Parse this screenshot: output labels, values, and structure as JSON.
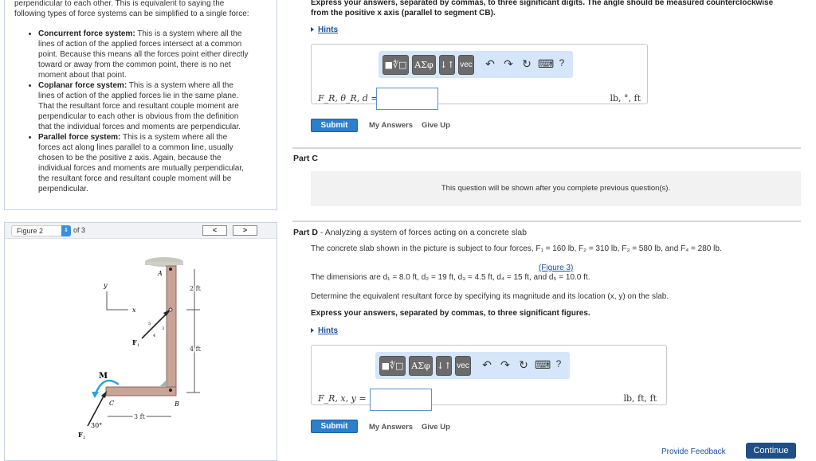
{
  "intro": {
    "line1": "perpendicular to each other. This is equivalent to saying the",
    "line2": "following types of force systems can be simplified to a single force:",
    "items": [
      {
        "title": "Concurrent force system:",
        "text": " This is a system where all the lines of action of the applied forces intersect at a common point. Because this means all the forces point either directly toward or away from the common point, there is no net moment about that point."
      },
      {
        "title": "Coplanar force system:",
        "text": " This is a system where all the lines of action of the applied forces lie in the same plane. That the resultant force and resultant couple moment are perpendicular to each other is obvious from the definition that the individual forces and moments are perpendicular."
      },
      {
        "title": "Parallel force system:",
        "text": " This is a system where all the forces act along lines parallel to a common line, usually chosen to be the positive z axis. Again, because the individual forces and moments are mutually perpendicular, the resultant force and resultant couple moment will be perpendicular."
      }
    ]
  },
  "figure": {
    "selected": "Figure 2",
    "of": "of 3",
    "prev": "<",
    "next": ">",
    "labels": {
      "A": "A",
      "B": "B",
      "C": "C",
      "y": "y",
      "x": "x",
      "F1": "F",
      "F1sub": "1",
      "F2": "F",
      "F2sub": "2",
      "M": "M",
      "d2ft": "2 ft",
      "d4ft": "4 ft",
      "d3ft": "3 ft",
      "ang": "30°",
      "s5": "5",
      "s3": "3",
      "s4": "4"
    }
  },
  "partB": {
    "instr1": "Express your answers, separated by commas, to three significant digits. The angle should be measured counterclockwise",
    "instr2": "from the positive x axis (parallel to segment CB).",
    "hints": "Hints",
    "label": "F_R, θ_R, d =",
    "units": "lb, °, ft",
    "submit": "Submit",
    "my_answers": "My Answers",
    "give_up": "Give Up"
  },
  "toolbar": {
    "templates": "■∜□",
    "greek": "ΑΣφ",
    "arrows": "↓↑",
    "vec": "vec",
    "undo": "↶",
    "redo": "↷",
    "reset": "↻",
    "keyboard": "⌨",
    "help": "?"
  },
  "partC": {
    "title": "Part C",
    "msg": "This question will be shown after you complete previous question(s)."
  },
  "partD": {
    "title": "Part D",
    "subtitle": " - Analyzing a system of forces acting on a concrete slab",
    "p1": "The concrete slab shown in the picture is subject to four forces, F₁ = 160 lb, F₂ = 310 lb, F₃ = 580 lb, and F₄ = 280 lb.",
    "figlink": "(Figure 3)",
    "p2": "The dimensions are d₁ = 8.0 ft, d₂ = 19 ft, d₃ = 4.5 ft, d₄ = 15 ft, and d₅ = 10.0 ft.",
    "p3": "Determine the equivalent resultant force by specifying its magnitude and its location (x, y) on the slab.",
    "instr": "Express your answers, separated by commas, to three significant figures.",
    "hints": "Hints",
    "label": "F_R, x, y =",
    "units": "lb, ft, ft",
    "submit": "Submit",
    "my_answers": "My Answers",
    "give_up": "Give Up"
  },
  "footer": {
    "feedback": "Provide Feedback",
    "continue": "Continue"
  }
}
